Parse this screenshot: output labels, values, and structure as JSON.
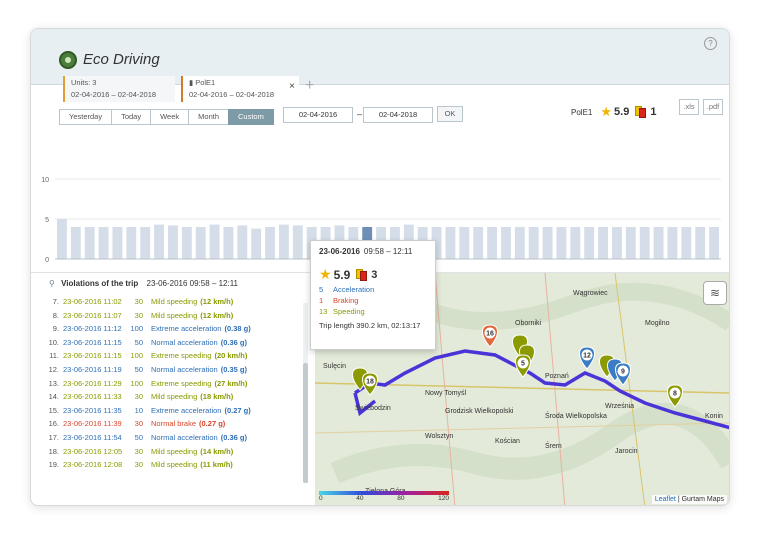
{
  "app": {
    "title": "Eco Driving",
    "help": "?"
  },
  "tabs": [
    {
      "line1": "Units: 3",
      "line2": "02-04-2016 – 02-04-2018"
    },
    {
      "line1": "PolE1",
      "line2": "02-04-2016 – 02-04-2018",
      "close": "×"
    }
  ],
  "add_tab": "+",
  "periods": [
    "Yesterday",
    "Today",
    "Week",
    "Month",
    "Custom"
  ],
  "active_period": "Custom",
  "date_from": "02-04-2016",
  "date_to": "02-04-2018",
  "dash": "–",
  "ok_label": "OK",
  "summary": {
    "unit": "PolE1",
    "rating": "5.9",
    "penalty": "1"
  },
  "export": {
    "xls": ".xls",
    "pdf": ".pdf"
  },
  "chart_data": {
    "type": "bar",
    "y_ticks": [
      "10",
      "5",
      "0"
    ],
    "ylim": [
      0,
      10
    ],
    "values": [
      5,
      4,
      4,
      4,
      4,
      4,
      4,
      4.3,
      4.2,
      4,
      4,
      4.3,
      4,
      4.2,
      3.8,
      4,
      4.3,
      4.2,
      4,
      4,
      4.2,
      4,
      4,
      4,
      4,
      4.3,
      4,
      4,
      4,
      4,
      4,
      4,
      4,
      4,
      4,
      4,
      4,
      4,
      4,
      4,
      4,
      4,
      4,
      4,
      4,
      4,
      4,
      4
    ],
    "highlighted_index": 22,
    "grid": true
  },
  "violations": {
    "title": "Violations of the trip",
    "range": "23-06-2016 09:58 – 12:11",
    "rows": [
      {
        "n": "7.",
        "time": "23-06-2016 11:02",
        "speed": "30",
        "desc": "Mild speeding",
        "value": "(12 km/h)",
        "sev": "mild"
      },
      {
        "n": "8.",
        "time": "23-06-2016 11:07",
        "speed": "30",
        "desc": "Mild speeding",
        "value": "(12 km/h)",
        "sev": "mild"
      },
      {
        "n": "9.",
        "time": "23-06-2016 11:12",
        "speed": "100",
        "desc": "Extreme acceleration",
        "value": "(0.38 g)",
        "sev": "blue"
      },
      {
        "n": "10.",
        "time": "23-06-2016 11:15",
        "speed": "50",
        "desc": "Normal acceleration",
        "value": "(0.36 g)",
        "sev": "blue"
      },
      {
        "n": "11.",
        "time": "23-06-2016 11:15",
        "speed": "100",
        "desc": "Extreme speeding",
        "value": "(20 km/h)",
        "sev": "mild"
      },
      {
        "n": "12.",
        "time": "23-06-2016 11:19",
        "speed": "50",
        "desc": "Normal acceleration",
        "value": "(0.35 g)",
        "sev": "blue"
      },
      {
        "n": "13.",
        "time": "23-06-2016 11:29",
        "speed": "100",
        "desc": "Extreme speeding",
        "value": "(27 km/h)",
        "sev": "mild"
      },
      {
        "n": "14.",
        "time": "23-06-2016 11:33",
        "speed": "30",
        "desc": "Mild speeding",
        "value": "(18 km/h)",
        "sev": "mild"
      },
      {
        "n": "15.",
        "time": "23-06-2016 11:35",
        "speed": "10",
        "desc": "Extreme acceleration",
        "value": "(0.27 g)",
        "sev": "blue"
      },
      {
        "n": "16.",
        "time": "23-06-2016 11:39",
        "speed": "30",
        "desc": "Normal brake",
        "value": "(0.27 g)",
        "sev": "red"
      },
      {
        "n": "17.",
        "time": "23-06-2016 11:54",
        "speed": "50",
        "desc": "Normal acceleration",
        "value": "(0.36 g)",
        "sev": "blue"
      },
      {
        "n": "18.",
        "time": "23-06-2016 12:05",
        "speed": "30",
        "desc": "Mild speeding",
        "value": "(14 km/h)",
        "sev": "mild"
      },
      {
        "n": "19.",
        "time": "23-06-2016 12:08",
        "speed": "30",
        "desc": "Mild speeding",
        "value": "(11 km/h)",
        "sev": "mild"
      }
    ]
  },
  "popup": {
    "date": "23-06-2016",
    "range": "09:58 – 12:11",
    "rating": "5.9",
    "penalty": "3",
    "acceleration_count": "5",
    "acceleration_label": "Acceleration",
    "braking_count": "1",
    "braking_label": "Braking",
    "speeding_count": "13",
    "speeding_label": "Speeding",
    "trip": "Trip length 390.2 km, 02:13:17"
  },
  "map": {
    "zoom_in": "+",
    "zoom_out": "–",
    "attribution_leaflet": "Leaflet",
    "attribution_rest": " | Gurtam Maps",
    "legend_labels": [
      "0",
      "40",
      "80",
      "120"
    ],
    "cities": [
      "Wągrowiec",
      "Oborniki",
      "Mogilno",
      "Nowy Tomyśl",
      "Grodzisk Wielkopolski",
      "Środa Wielkopolska",
      "Września",
      "Świebodzin",
      "Sulęcin",
      "Wolsztyn",
      "Kościan",
      "Śrem",
      "Jarocin",
      "Zielona Góra",
      "Poznań",
      "Konin"
    ],
    "markers": [
      "16",
      "5",
      "12",
      "9",
      "8",
      "18"
    ],
    "colors": {
      "mild": "#8a9a00",
      "blue": "#3a7dc4",
      "red": "#e06a3c",
      "route": "#4a34d8"
    }
  }
}
